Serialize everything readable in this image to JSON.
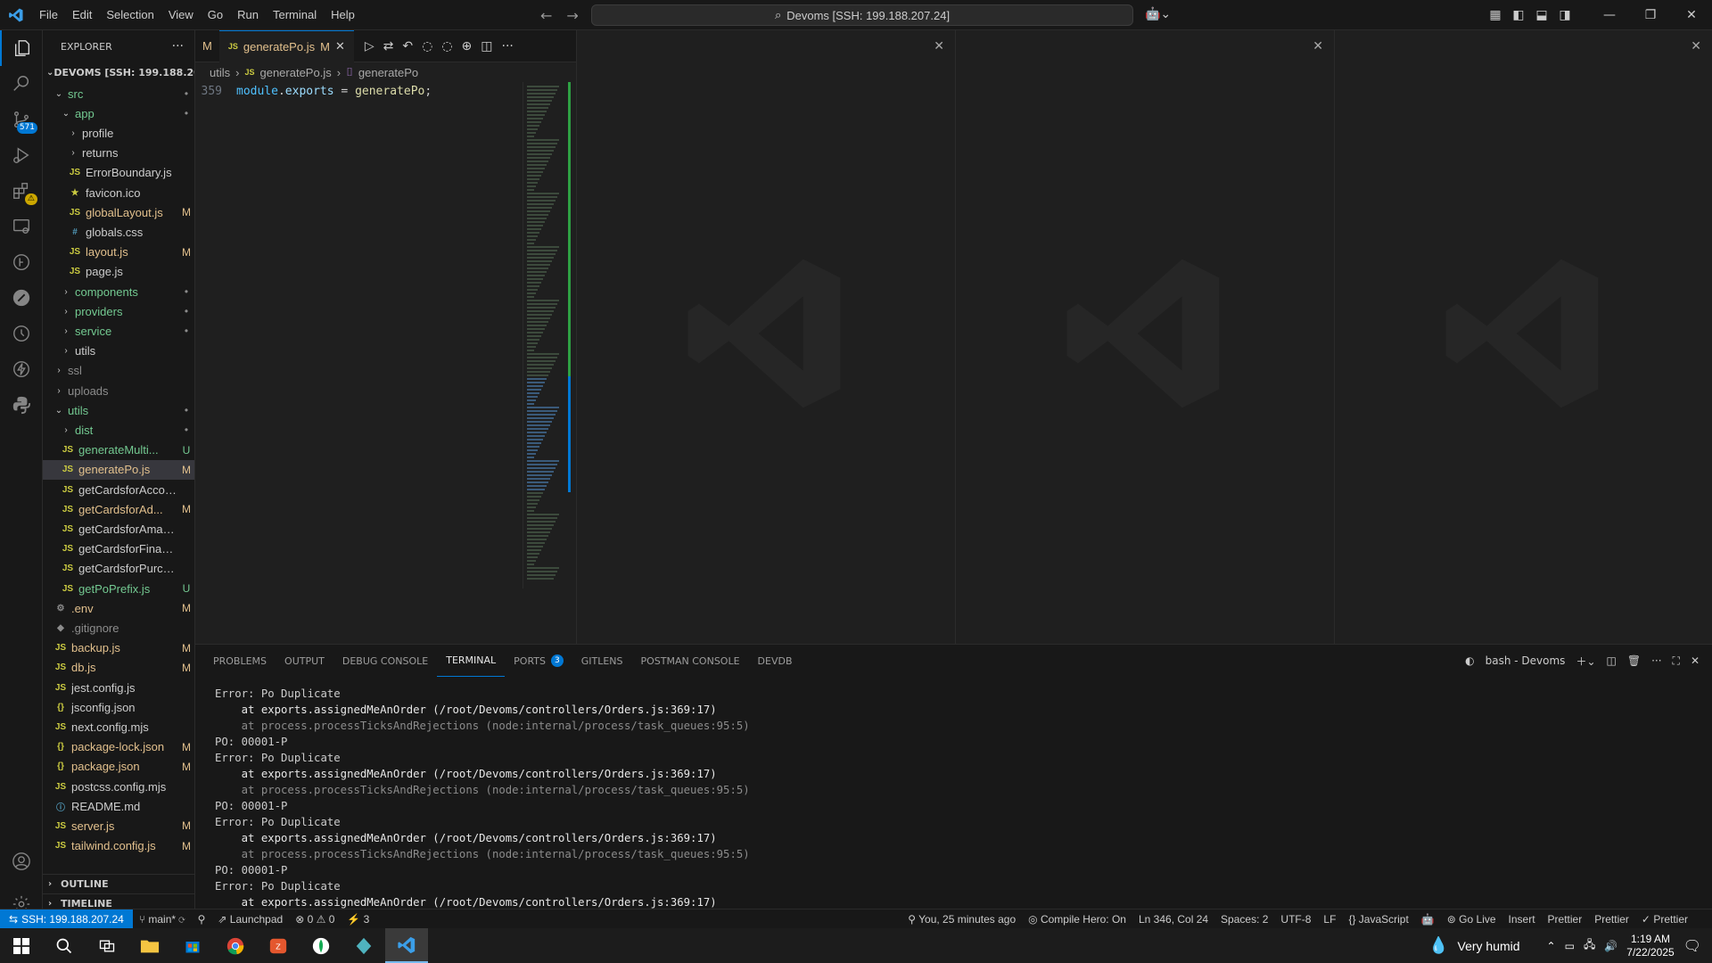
{
  "titlebar": {
    "menu": [
      "File",
      "Edit",
      "Selection",
      "View",
      "Go",
      "Run",
      "Terminal",
      "Help"
    ],
    "command_center": "Devoms [SSH: 199.188.207.24]"
  },
  "activity_badges": {
    "source_control": "571"
  },
  "sidebar": {
    "title": "EXPLORER",
    "root": "DEVOMS [SSH: 199.188.20...",
    "items": [
      {
        "label": "src",
        "kind": "folder-open",
        "status": "•"
      },
      {
        "label": "app",
        "kind": "folder-open",
        "status": "•"
      },
      {
        "label": "profile",
        "kind": "folder",
        "status": ""
      },
      {
        "label": "returns",
        "kind": "folder",
        "status": ""
      },
      {
        "label": "ErrorBoundary.js",
        "kind": "js",
        "status": ""
      },
      {
        "label": "favicon.ico",
        "kind": "ico",
        "status": ""
      },
      {
        "label": "globalLayout.js",
        "kind": "js",
        "status": "M"
      },
      {
        "label": "globals.css",
        "kind": "css",
        "status": ""
      },
      {
        "label": "layout.js",
        "kind": "js",
        "status": "M"
      },
      {
        "label": "page.js",
        "kind": "js",
        "status": ""
      },
      {
        "label": "components",
        "kind": "folder",
        "status": "•"
      },
      {
        "label": "providers",
        "kind": "folder",
        "status": "•"
      },
      {
        "label": "service",
        "kind": "folder",
        "status": "•"
      },
      {
        "label": "utils",
        "kind": "folder",
        "status": ""
      },
      {
        "label": "ssl",
        "kind": "folder",
        "status": ""
      },
      {
        "label": "uploads",
        "kind": "folder",
        "status": ""
      },
      {
        "label": "utils",
        "kind": "folder-open",
        "status": "•"
      },
      {
        "label": "dist",
        "kind": "folder",
        "status": "•"
      },
      {
        "label": "generateMulti...",
        "kind": "js",
        "status": "U"
      },
      {
        "label": "generatePo.js",
        "kind": "js",
        "status": "M"
      },
      {
        "label": "getCardsforAccount.js",
        "kind": "js",
        "status": ""
      },
      {
        "label": "getCardsforAd...",
        "kind": "js",
        "status": "M"
      },
      {
        "label": "getCardsforAmazon.js",
        "kind": "js",
        "status": ""
      },
      {
        "label": "getCardsforFinance.js",
        "kind": "js",
        "status": ""
      },
      {
        "label": "getCardsforPurchasi...",
        "kind": "js",
        "status": ""
      },
      {
        "label": "getPoPrefix.js",
        "kind": "js",
        "status": "U"
      },
      {
        "label": ".env",
        "kind": "gear",
        "status": "M"
      },
      {
        "label": ".gitignore",
        "kind": "git",
        "status": ""
      },
      {
        "label": "backup.js",
        "kind": "js",
        "status": "M"
      },
      {
        "label": "db.js",
        "kind": "js",
        "status": "M"
      },
      {
        "label": "jest.config.js",
        "kind": "js",
        "status": ""
      },
      {
        "label": "jsconfig.json",
        "kind": "json",
        "status": ""
      },
      {
        "label": "next.config.mjs",
        "kind": "js",
        "status": ""
      },
      {
        "label": "package-lock.json",
        "kind": "json",
        "status": "M"
      },
      {
        "label": "package.json",
        "kind": "json",
        "status": "M"
      },
      {
        "label": "postcss.config.mjs",
        "kind": "js",
        "status": ""
      },
      {
        "label": "README.md",
        "kind": "info",
        "status": ""
      },
      {
        "label": "server.js",
        "kind": "js",
        "status": "M"
      },
      {
        "label": "tailwind.config.js",
        "kind": "js",
        "status": "M"
      }
    ],
    "outline": "OUTLINE",
    "timeline": "TIMELINE"
  },
  "editor": {
    "prev_tab_status": "M",
    "active_tab": "generatePo.js",
    "active_tab_status": "M",
    "breadcrumb": [
      "utils",
      "generatePo.js",
      "generatePo"
    ],
    "line_number": "359",
    "code_obj": "module",
    "code_dot": ".",
    "code_prop": "exports",
    "code_eq": " = ",
    "code_fn": "generatePo",
    "code_end": ";"
  },
  "panel": {
    "tabs": [
      "PROBLEMS",
      "OUTPUT",
      "DEBUG CONSOLE",
      "TERMINAL",
      "PORTS",
      "GITLENS",
      "POSTMAN CONSOLE",
      "DEVDB"
    ],
    "ports_badge": "3",
    "terminal_name": "bash - Devoms",
    "lines": [
      {
        "t": "Error: Po Duplicate",
        "c": "norm"
      },
      {
        "t": "    at exports.assignedMeAnOrder (/root/Devoms/controllers/Orders.js:369:17)",
        "c": "frame"
      },
      {
        "t": "    at process.processTicksAndRejections (node:internal/process/task_queues:95:5)",
        "c": "dim"
      },
      {
        "t": "PO: 00001-P",
        "c": "norm"
      },
      {
        "t": "Error: Po Duplicate",
        "c": "norm"
      },
      {
        "t": "    at exports.assignedMeAnOrder (/root/Devoms/controllers/Orders.js:369:17)",
        "c": "frame"
      },
      {
        "t": "    at process.processTicksAndRejections (node:internal/process/task_queues:95:5)",
        "c": "dim"
      },
      {
        "t": "PO: 00001-P",
        "c": "norm"
      },
      {
        "t": "Error: Po Duplicate",
        "c": "norm"
      },
      {
        "t": "    at exports.assignedMeAnOrder (/root/Devoms/controllers/Orders.js:369:17)",
        "c": "frame"
      },
      {
        "t": "    at process.processTicksAndRejections (node:internal/process/task_queues:95:5)",
        "c": "dim"
      },
      {
        "t": "PO: 00001-P",
        "c": "norm"
      },
      {
        "t": "Error: Po Duplicate",
        "c": "norm"
      },
      {
        "t": "    at exports.assignedMeAnOrder (/root/Devoms/controllers/Orders.js:369:17)",
        "c": "frame"
      }
    ]
  },
  "status": {
    "remote": "SSH: 199.188.207.24",
    "branch": "main*",
    "launchpad": "Launchpad",
    "errors": "0",
    "warnings": "0",
    "ports": "3",
    "blame": "You, 25 minutes ago",
    "compile_hero": "Compile Hero: On",
    "position": "Ln 346, Col 24",
    "spaces": "Spaces: 2",
    "encoding": "UTF-8",
    "eol": "LF",
    "language": "JavaScript",
    "golive": "Go Live",
    "insert": "Insert",
    "prettier1": "Prettier",
    "prettier2": "Prettier",
    "prettier3": "Prettier"
  },
  "taskbar": {
    "weather": "Very humid",
    "time": "1:19 AM",
    "date": "7/22/2025"
  }
}
